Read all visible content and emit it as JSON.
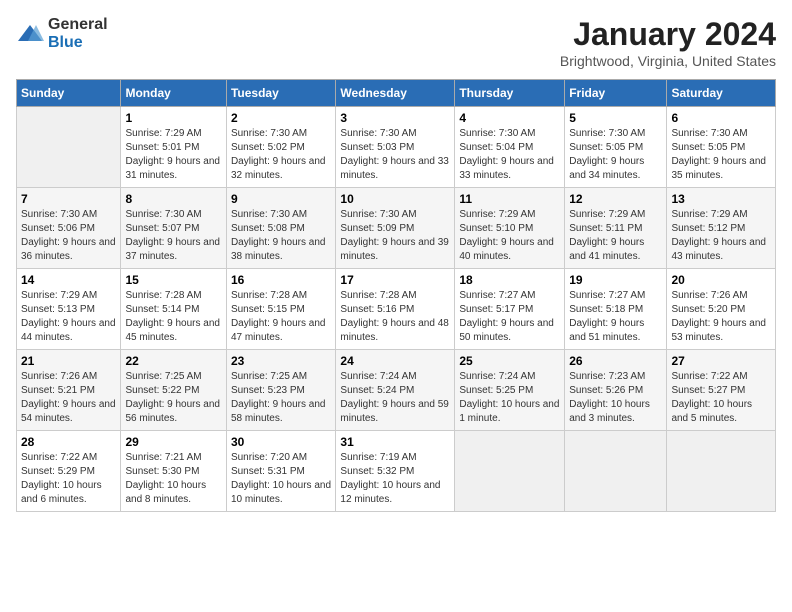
{
  "logo": {
    "general": "General",
    "blue": "Blue"
  },
  "title": "January 2024",
  "subtitle": "Brightwood, Virginia, United States",
  "days_header": [
    "Sunday",
    "Monday",
    "Tuesday",
    "Wednesday",
    "Thursday",
    "Friday",
    "Saturday"
  ],
  "weeks": [
    [
      {
        "day": "",
        "sunrise": "",
        "sunset": "",
        "daylight": ""
      },
      {
        "day": "1",
        "sunrise": "Sunrise: 7:29 AM",
        "sunset": "Sunset: 5:01 PM",
        "daylight": "Daylight: 9 hours and 31 minutes."
      },
      {
        "day": "2",
        "sunrise": "Sunrise: 7:30 AM",
        "sunset": "Sunset: 5:02 PM",
        "daylight": "Daylight: 9 hours and 32 minutes."
      },
      {
        "day": "3",
        "sunrise": "Sunrise: 7:30 AM",
        "sunset": "Sunset: 5:03 PM",
        "daylight": "Daylight: 9 hours and 33 minutes."
      },
      {
        "day": "4",
        "sunrise": "Sunrise: 7:30 AM",
        "sunset": "Sunset: 5:04 PM",
        "daylight": "Daylight: 9 hours and 33 minutes."
      },
      {
        "day": "5",
        "sunrise": "Sunrise: 7:30 AM",
        "sunset": "Sunset: 5:05 PM",
        "daylight": "Daylight: 9 hours and 34 minutes."
      },
      {
        "day": "6",
        "sunrise": "Sunrise: 7:30 AM",
        "sunset": "Sunset: 5:05 PM",
        "daylight": "Daylight: 9 hours and 35 minutes."
      }
    ],
    [
      {
        "day": "7",
        "sunrise": "Sunrise: 7:30 AM",
        "sunset": "Sunset: 5:06 PM",
        "daylight": "Daylight: 9 hours and 36 minutes."
      },
      {
        "day": "8",
        "sunrise": "Sunrise: 7:30 AM",
        "sunset": "Sunset: 5:07 PM",
        "daylight": "Daylight: 9 hours and 37 minutes."
      },
      {
        "day": "9",
        "sunrise": "Sunrise: 7:30 AM",
        "sunset": "Sunset: 5:08 PM",
        "daylight": "Daylight: 9 hours and 38 minutes."
      },
      {
        "day": "10",
        "sunrise": "Sunrise: 7:30 AM",
        "sunset": "Sunset: 5:09 PM",
        "daylight": "Daylight: 9 hours and 39 minutes."
      },
      {
        "day": "11",
        "sunrise": "Sunrise: 7:29 AM",
        "sunset": "Sunset: 5:10 PM",
        "daylight": "Daylight: 9 hours and 40 minutes."
      },
      {
        "day": "12",
        "sunrise": "Sunrise: 7:29 AM",
        "sunset": "Sunset: 5:11 PM",
        "daylight": "Daylight: 9 hours and 41 minutes."
      },
      {
        "day": "13",
        "sunrise": "Sunrise: 7:29 AM",
        "sunset": "Sunset: 5:12 PM",
        "daylight": "Daylight: 9 hours and 43 minutes."
      }
    ],
    [
      {
        "day": "14",
        "sunrise": "Sunrise: 7:29 AM",
        "sunset": "Sunset: 5:13 PM",
        "daylight": "Daylight: 9 hours and 44 minutes."
      },
      {
        "day": "15",
        "sunrise": "Sunrise: 7:28 AM",
        "sunset": "Sunset: 5:14 PM",
        "daylight": "Daylight: 9 hours and 45 minutes."
      },
      {
        "day": "16",
        "sunrise": "Sunrise: 7:28 AM",
        "sunset": "Sunset: 5:15 PM",
        "daylight": "Daylight: 9 hours and 47 minutes."
      },
      {
        "day": "17",
        "sunrise": "Sunrise: 7:28 AM",
        "sunset": "Sunset: 5:16 PM",
        "daylight": "Daylight: 9 hours and 48 minutes."
      },
      {
        "day": "18",
        "sunrise": "Sunrise: 7:27 AM",
        "sunset": "Sunset: 5:17 PM",
        "daylight": "Daylight: 9 hours and 50 minutes."
      },
      {
        "day": "19",
        "sunrise": "Sunrise: 7:27 AM",
        "sunset": "Sunset: 5:18 PM",
        "daylight": "Daylight: 9 hours and 51 minutes."
      },
      {
        "day": "20",
        "sunrise": "Sunrise: 7:26 AM",
        "sunset": "Sunset: 5:20 PM",
        "daylight": "Daylight: 9 hours and 53 minutes."
      }
    ],
    [
      {
        "day": "21",
        "sunrise": "Sunrise: 7:26 AM",
        "sunset": "Sunset: 5:21 PM",
        "daylight": "Daylight: 9 hours and 54 minutes."
      },
      {
        "day": "22",
        "sunrise": "Sunrise: 7:25 AM",
        "sunset": "Sunset: 5:22 PM",
        "daylight": "Daylight: 9 hours and 56 minutes."
      },
      {
        "day": "23",
        "sunrise": "Sunrise: 7:25 AM",
        "sunset": "Sunset: 5:23 PM",
        "daylight": "Daylight: 9 hours and 58 minutes."
      },
      {
        "day": "24",
        "sunrise": "Sunrise: 7:24 AM",
        "sunset": "Sunset: 5:24 PM",
        "daylight": "Daylight: 9 hours and 59 minutes."
      },
      {
        "day": "25",
        "sunrise": "Sunrise: 7:24 AM",
        "sunset": "Sunset: 5:25 PM",
        "daylight": "Daylight: 10 hours and 1 minute."
      },
      {
        "day": "26",
        "sunrise": "Sunrise: 7:23 AM",
        "sunset": "Sunset: 5:26 PM",
        "daylight": "Daylight: 10 hours and 3 minutes."
      },
      {
        "day": "27",
        "sunrise": "Sunrise: 7:22 AM",
        "sunset": "Sunset: 5:27 PM",
        "daylight": "Daylight: 10 hours and 5 minutes."
      }
    ],
    [
      {
        "day": "28",
        "sunrise": "Sunrise: 7:22 AM",
        "sunset": "Sunset: 5:29 PM",
        "daylight": "Daylight: 10 hours and 6 minutes."
      },
      {
        "day": "29",
        "sunrise": "Sunrise: 7:21 AM",
        "sunset": "Sunset: 5:30 PM",
        "daylight": "Daylight: 10 hours and 8 minutes."
      },
      {
        "day": "30",
        "sunrise": "Sunrise: 7:20 AM",
        "sunset": "Sunset: 5:31 PM",
        "daylight": "Daylight: 10 hours and 10 minutes."
      },
      {
        "day": "31",
        "sunrise": "Sunrise: 7:19 AM",
        "sunset": "Sunset: 5:32 PM",
        "daylight": "Daylight: 10 hours and 12 minutes."
      },
      {
        "day": "",
        "sunrise": "",
        "sunset": "",
        "daylight": ""
      },
      {
        "day": "",
        "sunrise": "",
        "sunset": "",
        "daylight": ""
      },
      {
        "day": "",
        "sunrise": "",
        "sunset": "",
        "daylight": ""
      }
    ]
  ]
}
